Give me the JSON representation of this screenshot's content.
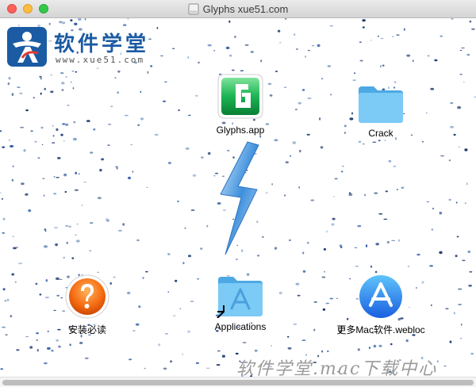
{
  "window": {
    "title": "Glyphs xue51.com",
    "disk_icon": "disk-image-icon"
  },
  "logo": {
    "title": "软件学堂",
    "url": "www.xue51.com"
  },
  "items": {
    "glyphs_app": {
      "label": "Glyphs.app",
      "icon": "glyphs-app-icon"
    },
    "crack": {
      "label": "Crack",
      "icon": "folder-icon"
    },
    "install": {
      "label": "安装必读",
      "icon": "help-icon"
    },
    "applications": {
      "label": "Applications",
      "icon": "applications-folder-icon"
    },
    "more": {
      "label": "更多Mac软件.webloc",
      "icon": "app-store-icon"
    }
  },
  "arrow_icon": "lightning-arrow-icon",
  "watermark": "软件学堂.mac下载中心",
  "colors": {
    "accent": "#1b5ba3",
    "glyphs_green": "#1cb454",
    "folder_blue": "#5fbdf3"
  }
}
